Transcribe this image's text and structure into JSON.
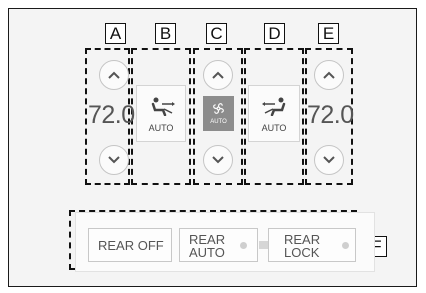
{
  "labels": {
    "a": "A",
    "b": "B",
    "c": "C",
    "d": "D",
    "e": "E",
    "f": "F"
  },
  "left_zone": {
    "temperature": "72.0"
  },
  "right_zone": {
    "temperature": "72.0"
  },
  "left_mode": {
    "auto_label": "AUTO",
    "icon": "driver-airflow-icon"
  },
  "fan": {
    "auto_label": "AUTO",
    "icon": "fan-icon"
  },
  "right_mode": {
    "auto_label": "AUTO",
    "icon": "passenger-airflow-icon"
  },
  "rear": {
    "off_label": "REAR OFF",
    "auto_line1": "REAR",
    "auto_line2": "AUTO",
    "lock_line1": "REAR",
    "lock_line2": "LOCK"
  },
  "colors": {
    "fan_active": "#8c8c8c",
    "indicator_off": "#cfcfcf"
  }
}
